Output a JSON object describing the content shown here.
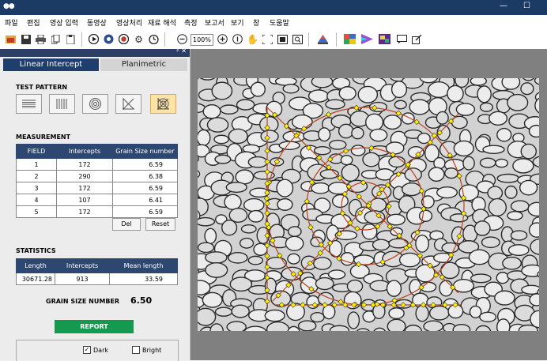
{
  "menu": [
    "파일",
    "편집",
    "영상 입력",
    "동영상",
    "영상처리",
    "재료 해석",
    "측정",
    "보고서",
    "보기",
    "창",
    "도움말"
  ],
  "toolbar": {
    "zoom": "100%"
  },
  "tabs": {
    "active": "Linear Intercept",
    "inactive": "Planimetric"
  },
  "test_pattern": {
    "title": "TEST PATTERN",
    "selected_index": 4,
    "icons": [
      "horizontal-lines-icon",
      "vertical-lines-icon",
      "concentric-circles-icon",
      "cross-lines-icon",
      "circles-cross-icon"
    ]
  },
  "measurement": {
    "title": "MEASUREMENT",
    "headers": [
      "FIELD",
      "Intercepts",
      "Grain Size number"
    ],
    "rows": [
      [
        "1",
        "172",
        "6.59"
      ],
      [
        "2",
        "290",
        "6.38"
      ],
      [
        "3",
        "172",
        "6.59"
      ],
      [
        "4",
        "107",
        "6.41"
      ],
      [
        "5",
        "172",
        "6.59"
      ]
    ],
    "del_label": "Del",
    "reset_label": "Reset"
  },
  "statistics": {
    "title": "STATISTICS",
    "headers": [
      "Length",
      "Intercepts",
      "Mean length"
    ],
    "row": [
      "30671.28",
      "913",
      "33.59"
    ]
  },
  "grain_size": {
    "label": "GRAIN SIZE NUMBER",
    "value": "6.50"
  },
  "report_label": "REPORT",
  "options": {
    "dark_label": "Dark",
    "dark_checked": true,
    "bright_label": "Bright",
    "bright_checked": false
  },
  "colors": {
    "title_bar": "#1b3a64",
    "accent": "#1e3e6c",
    "report": "#139a50",
    "pattern_line": "#c0401a",
    "intercept": "#ffee00"
  }
}
